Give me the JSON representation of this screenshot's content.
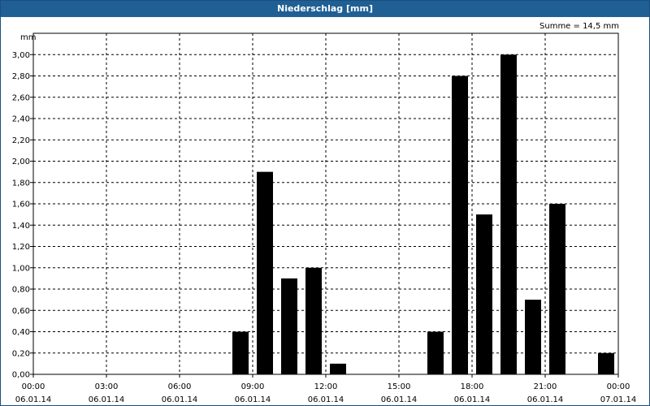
{
  "window": {
    "title": "Niederschlag [mm]"
  },
  "colors": {
    "titlebar": "#1f5f94",
    "bar": "#000000",
    "grid": "#000000",
    "background": "#ffffff"
  },
  "chart_data": {
    "type": "bar",
    "title": "Niederschlag [mm]",
    "ylabel": "mm",
    "annotation": "Summe = 14,5 mm",
    "ylim": [
      0,
      3.2
    ],
    "yticks": [
      "0,00",
      "0,20",
      "0,40",
      "0,60",
      "0,80",
      "1,00",
      "1,20",
      "1,40",
      "1,60",
      "1,80",
      "2,00",
      "2,20",
      "2,40",
      "2,60",
      "2,80",
      "3,00"
    ],
    "x_range": [
      "06.01.14 00:00",
      "07.01.14 00:00"
    ],
    "xticks": [
      {
        "time": "00:00",
        "date": "06.01.14"
      },
      {
        "time": "03:00",
        "date": "06.01.14"
      },
      {
        "time": "06:00",
        "date": "06.01.14"
      },
      {
        "time": "09:00",
        "date": "06.01.14"
      },
      {
        "time": "12:00",
        "date": "06.01.14"
      },
      {
        "time": "15:00",
        "date": "06.01.14"
      },
      {
        "time": "18:00",
        "date": "06.01.14"
      },
      {
        "time": "21:00",
        "date": "06.01.14"
      },
      {
        "time": "00:00",
        "date": "07.01.14"
      }
    ],
    "grid": true,
    "categories": [
      "00:00",
      "01:00",
      "02:00",
      "03:00",
      "04:00",
      "05:00",
      "06:00",
      "07:00",
      "08:00",
      "09:00",
      "10:00",
      "11:00",
      "12:00",
      "13:00",
      "14:00",
      "15:00",
      "16:00",
      "17:00",
      "18:00",
      "19:00",
      "20:00",
      "21:00",
      "22:00",
      "23:00"
    ],
    "values": [
      0,
      0,
      0,
      0,
      0,
      0,
      0,
      0,
      0.4,
      1.9,
      0.9,
      1.0,
      0.1,
      0,
      0,
      0,
      0.4,
      2.8,
      1.5,
      3.0,
      0.7,
      1.6,
      0,
      0.2
    ]
  }
}
